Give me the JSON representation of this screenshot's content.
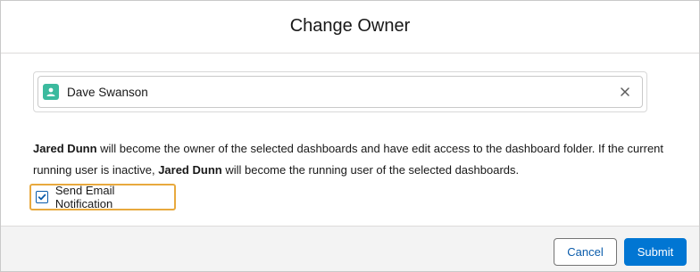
{
  "modal": {
    "title": "Change Owner"
  },
  "lookup": {
    "selected_name": "Dave Swanson",
    "icon": "contact-icon",
    "clear_icon": "close-icon",
    "icon_color": "#3bba9e"
  },
  "description": {
    "owner_name_1": "Jared Dunn",
    "text_1": " will become the owner of the selected dashboards and have edit access to the dashboard folder. If the current running user is inactive, ",
    "owner_name_2": "Jared Dunn",
    "text_2": " will become the running user of the selected dashboards."
  },
  "notification": {
    "label": "Send Email Notification",
    "checked": true,
    "highlight_color": "#e8a93e"
  },
  "footer": {
    "cancel_label": "Cancel",
    "submit_label": "Submit",
    "brand_color": "#0176d3"
  }
}
